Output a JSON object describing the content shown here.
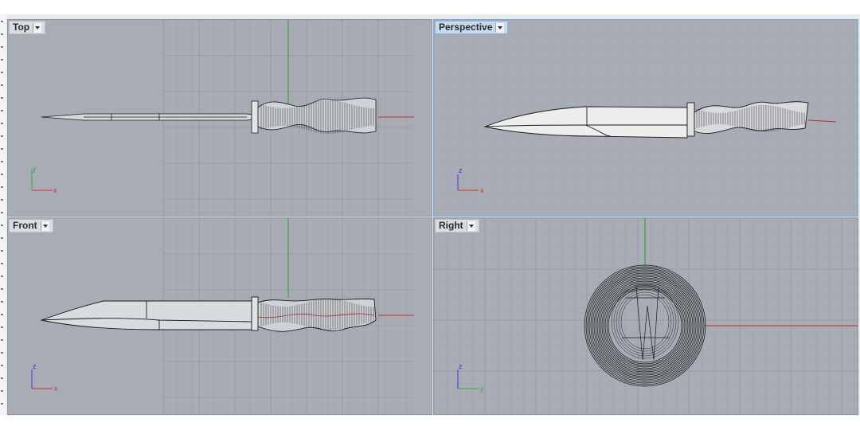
{
  "viewports": {
    "top": {
      "label": "Top",
      "axis_h": "x",
      "axis_v": "y",
      "axis_h_color": "#c83232",
      "axis_v_color": "#3aa83a"
    },
    "perspective": {
      "label": "Perspective",
      "axis_h": "x",
      "axis_v": "z",
      "axis_h_color": "#c83232",
      "axis_v_color": "#3a3acc"
    },
    "front": {
      "label": "Front",
      "axis_h": "x",
      "axis_v": "z",
      "axis_h_color": "#c83232",
      "axis_v_color": "#3a3acc"
    },
    "right": {
      "label": "Right",
      "axis_h": "y",
      "axis_v": "z",
      "axis_h_color": "#3aa83a",
      "axis_v_color": "#3a3acc"
    }
  },
  "colors": {
    "viewport_bg": "#a8adb5",
    "grid_minor": "#9ea3ab",
    "grid_major": "#8c929a",
    "world_x": "#b83030",
    "world_y": "#2e9a2e",
    "model_wire": "#1a1a1a",
    "model_fill": "#eeeeee",
    "active_label": "#c9d9ee"
  },
  "icons": [
    "dropdown-arrow-icon",
    "axis-gizmo-icon"
  ]
}
